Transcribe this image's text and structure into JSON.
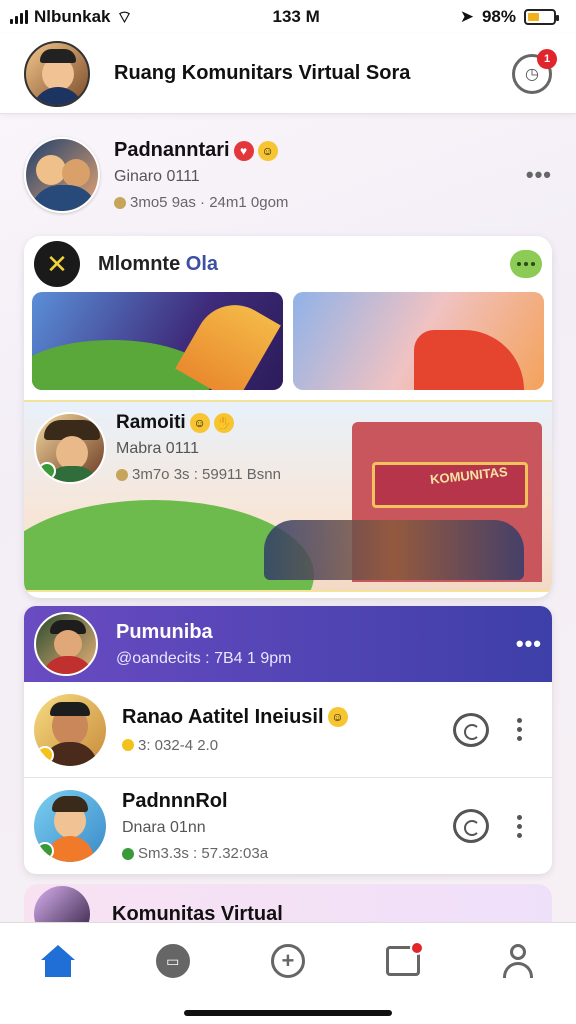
{
  "status_bar": {
    "carrier": "Nlbunkak",
    "time": "133 M",
    "battery": "98%",
    "battery_level": 0.45
  },
  "header": {
    "title": "Ruang Komunitars Virtual Sora",
    "notification_count": "1"
  },
  "post1": {
    "name": "Padnanntari",
    "sub": "Ginaro 0111",
    "meta": "3mo5 9as · 24m1 0gom"
  },
  "group_card": {
    "title_main": "Mlomnte",
    "title_accent": "Ola",
    "feature": {
      "name": "Ramoiti",
      "sub": "Mabra 0111",
      "meta": "3m7o 3s : 59911 Bsnn",
      "sign": "KOMUNITAS"
    }
  },
  "list_card": {
    "head": {
      "name": "Pumuniba",
      "meta": "@oandecits : 7B4 1 9pm"
    },
    "rows": [
      {
        "name": "Ranao Aatitel Ineiusil",
        "meta": "3: 032-4 2.0"
      },
      {
        "name": "PadnnnRol",
        "sub": "Dnara 01nn",
        "meta": "Sm3.3s : 57.32:03a"
      }
    ]
  },
  "partial_card": {
    "title": "Komunitas Virtual"
  },
  "bottom_nav": {
    "items": [
      "home",
      "messages",
      "create",
      "activity",
      "profile"
    ]
  },
  "colors": {
    "accent": "#1f6fd6",
    "list_head_start": "#6a4bc2",
    "list_head_end": "#3e3fa8",
    "badge": "#e0262c"
  }
}
